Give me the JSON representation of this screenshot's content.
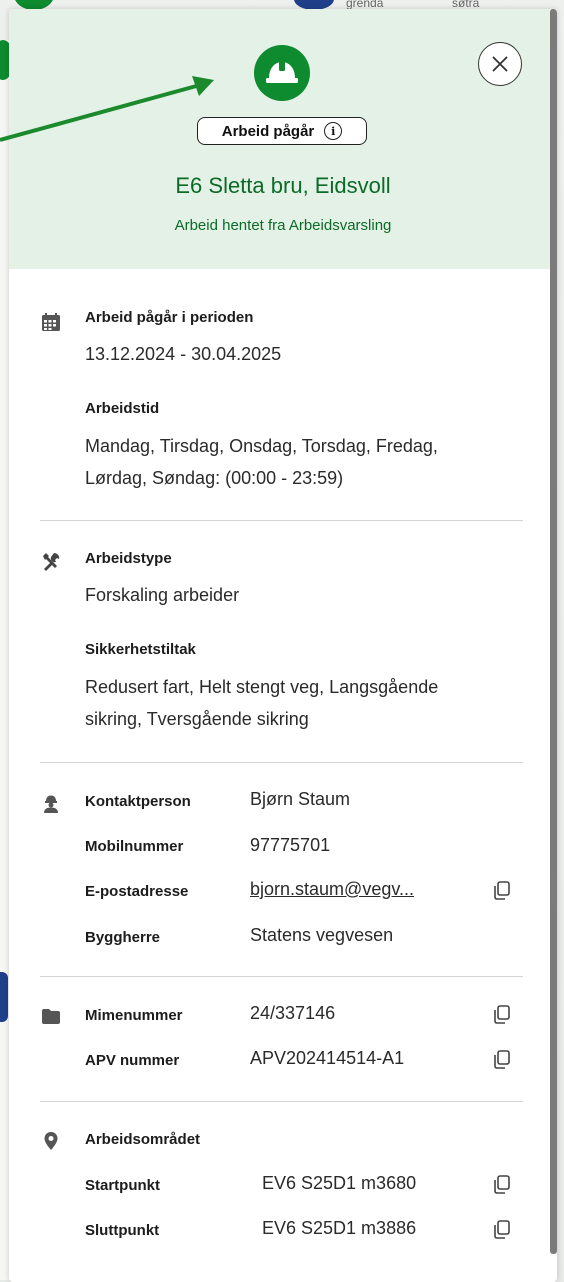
{
  "header": {
    "status_label": "Arbeid pågår",
    "title": "E6 Sletta bru, Eidsvoll",
    "subtitle": "Arbeid hentet fra Arbeidsvarsling"
  },
  "period": {
    "label": "Arbeid pågår i perioden",
    "value": "13.12.2024 - 30.04.2025",
    "worktime_label": "Arbeidstid",
    "worktime_value_line1": "Mandag, Tirsdag, Onsdag, Torsdag, Fredag,",
    "worktime_value_line2": "Lørdag, Søndag: (00:00 - 23:59)"
  },
  "worktype": {
    "label": "Arbeidstype",
    "value": "Forskaling arbeider",
    "safety_label": "Sikkerhetstiltak",
    "safety_value_line1": "Redusert fart, Helt stengt veg, Langsgående",
    "safety_value_line2": "sikring, Tversgående sikring"
  },
  "contact": {
    "person_label": "Kontaktperson",
    "person_value": "Bjørn Staum",
    "mobile_label": "Mobilnummer",
    "mobile_value": "97775701",
    "email_label": "E-postadresse",
    "email_value": "bjorn.staum@vegv...",
    "builder_label": "Byggherre",
    "builder_value": "Statens vegvesen"
  },
  "ids": {
    "mime_label": "Mimenummer",
    "mime_value": "24/337146",
    "apv_label": "APV nummer",
    "apv_value": "APV202414514-A1"
  },
  "area": {
    "label": "Arbeidsområdet",
    "start_label": "Startpunkt",
    "start_value": "EV6 S25D1 m3680",
    "end_label": "Sluttpunkt",
    "end_value": "EV6 S25D1 m3886"
  },
  "map": {
    "labels": [
      "grenda",
      "søtra"
    ]
  },
  "colors": {
    "accent": "#0e8a2f",
    "header_bg": "#e4f1e6",
    "title": "#0b6b27",
    "arrow": "#1a8a2c"
  }
}
